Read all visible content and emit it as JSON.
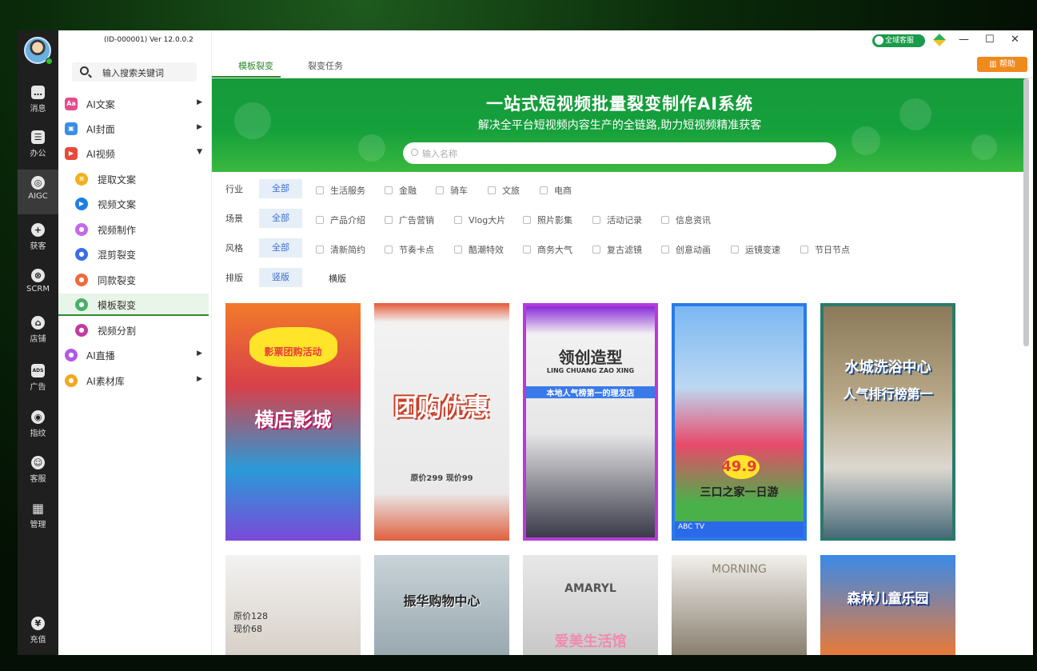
{
  "window": {
    "version": "(ID-000001)  Ver 12.0.0.2",
    "cs_label": "全域客服",
    "minimize": "—",
    "maximize": "☐",
    "close": "✕"
  },
  "rail": {
    "items": [
      {
        "label": "消息",
        "icon": "message-icon"
      },
      {
        "label": "办公",
        "icon": "office-icon"
      },
      {
        "label": "AIGC",
        "icon": "aigc-icon"
      },
      {
        "label": "获客",
        "icon": "user-add-icon"
      },
      {
        "label": "SCRM",
        "icon": "scrm-icon"
      },
      {
        "label": "店铺",
        "icon": "store-icon"
      },
      {
        "label": "广告",
        "icon": "ads-icon"
      },
      {
        "label": "指纹",
        "icon": "fingerprint-icon"
      },
      {
        "label": "客服",
        "icon": "headset-icon"
      },
      {
        "label": "管理",
        "icon": "grid-icon"
      }
    ],
    "recharge": "充值"
  },
  "sidebar": {
    "search_placeholder": "输入搜索关键词",
    "menu": [
      {
        "label": "AI文案",
        "color": "#e84a8a",
        "icon": "Aa"
      },
      {
        "label": "AI封面",
        "color": "#3a8ee6",
        "icon": "▣"
      },
      {
        "label": "AI视频",
        "color": "#e84a3a",
        "icon": "▶"
      },
      {
        "label": "提取文案",
        "color": "#f2b01e",
        "icon": "≡"
      },
      {
        "label": "视频文案",
        "color": "#1e7ee6",
        "icon": "▶"
      },
      {
        "label": "视频制作",
        "color": "#c46ae6",
        "icon": "●"
      },
      {
        "label": "混剪裂变",
        "color": "#3a6fe6",
        "icon": "●"
      },
      {
        "label": "同款裂变",
        "color": "#f06a3a",
        "icon": "●"
      },
      {
        "label": "模板裂变",
        "color": "#4ab06a",
        "icon": "●"
      },
      {
        "label": "视频分割",
        "color": "#c43aa0",
        "icon": "●"
      },
      {
        "label": "AI直播",
        "color": "#b05ae6",
        "icon": "●"
      },
      {
        "label": "AI素材库",
        "color": "#f2a81e",
        "icon": "●"
      }
    ]
  },
  "tabs": [
    "模板裂变",
    "裂变任务"
  ],
  "help": "帮助",
  "banner": {
    "title": "一站式短视频批量裂变制作AI系统",
    "subtitle": "解决全平台短视频内容生产的全链路,助力短视频精准获客",
    "search_placeholder": "输入名称"
  },
  "filters": {
    "industry": {
      "label": "行业",
      "all": "全部",
      "options": [
        "生活服务",
        "金融",
        "骑车",
        "文旅",
        "电商"
      ]
    },
    "scene": {
      "label": "场景",
      "all": "全部",
      "options": [
        "产品介绍",
        "广告营销",
        "Vlog大片",
        "照片影集",
        "活动记录",
        "信息资讯"
      ]
    },
    "style": {
      "label": "风格",
      "all": "全部",
      "options": [
        "清新简约",
        "节奏卡点",
        "酷潮特效",
        "商务大气",
        "复古滤镜",
        "创意动画",
        "运镜变速",
        "节日节点"
      ]
    },
    "layout": {
      "label": "排版",
      "vertical": "竖版",
      "horizontal": "横版"
    }
  },
  "cards_row1": [
    {
      "title": "横店影城",
      "tag": "影票团购活动"
    },
    {
      "title": "团购优惠",
      "tag": "原价299 现价99"
    },
    {
      "title": "领创造型",
      "tag": "LING CHUANG ZAO XING",
      "caption": "本地人气榜第一的理发店"
    },
    {
      "title": "三口之家一日游",
      "tag": "49.9",
      "caption": "ABC TV"
    },
    {
      "title": "水城洗浴中心",
      "tag": "人气排行榜第一"
    }
  ],
  "cards_row2": [
    {
      "title": "原价128",
      "tag": "现价68"
    },
    {
      "title": "振华购物中心",
      "tag": ""
    },
    {
      "title": "爱美生活馆",
      "tag": "AMARYL"
    },
    {
      "title": "MORNING",
      "tag": ""
    },
    {
      "title": "森林儿童乐园",
      "tag": ""
    }
  ]
}
